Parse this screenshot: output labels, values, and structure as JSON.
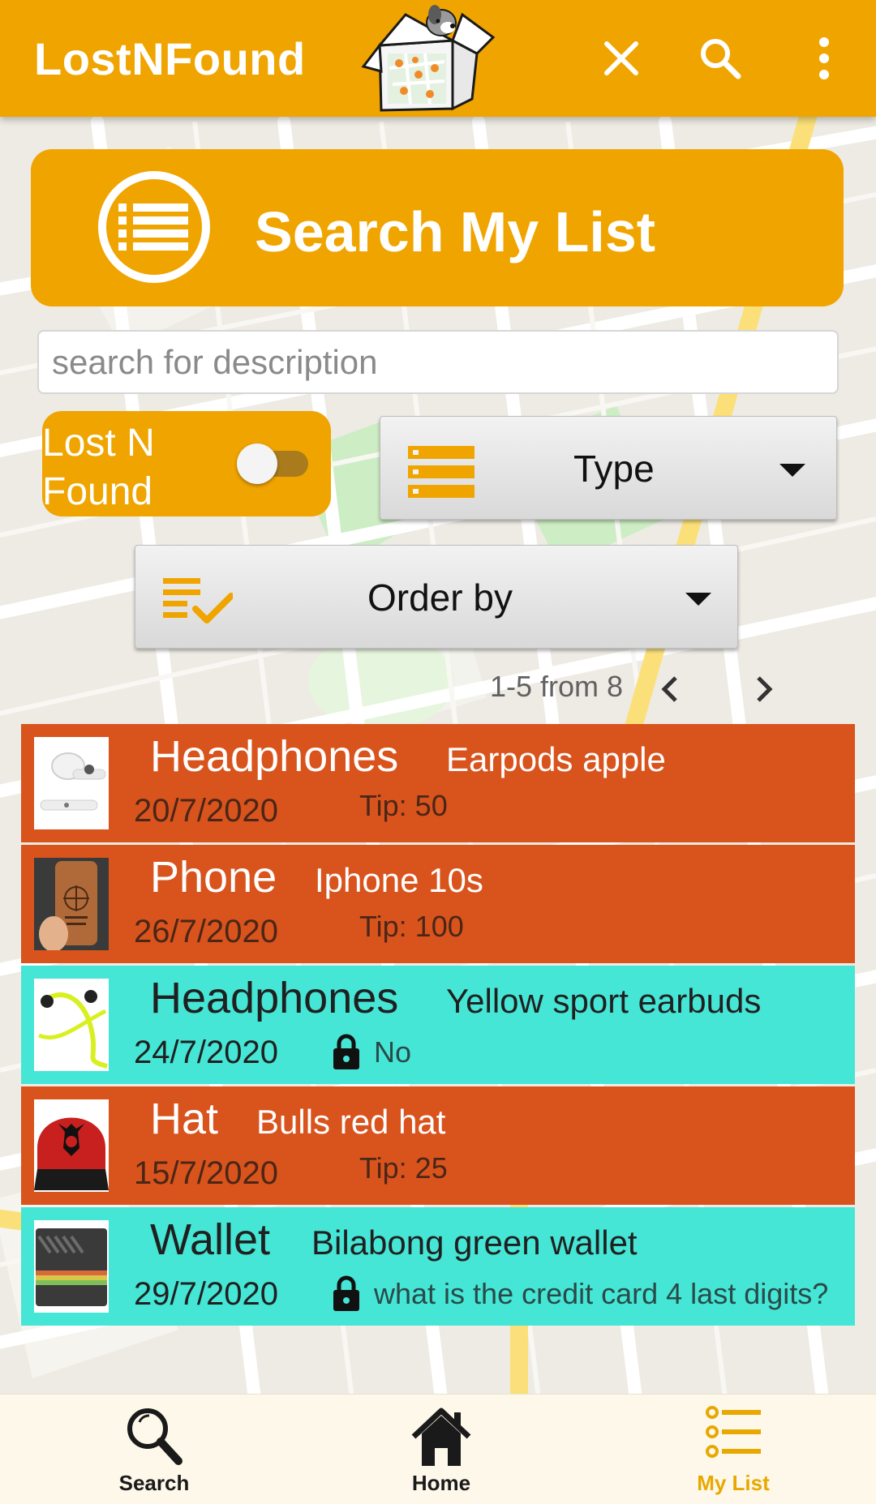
{
  "app_bar": {
    "title": "LostNFound",
    "icons": [
      "box-map-logo-icon",
      "close-icon",
      "search-icon",
      "more-vert-icon"
    ]
  },
  "banner": {
    "title": "Search My List",
    "icon": "list-circle-icon"
  },
  "search": {
    "placeholder": "search for description",
    "value": ""
  },
  "filters": {
    "lost_found_label": "Lost N Found",
    "lost_found_on": false,
    "type_label": "Type",
    "order_label": "Order by"
  },
  "pagination": {
    "info": "1-5 from 8"
  },
  "items": [
    {
      "status": "lost",
      "type": "Headphones",
      "description": "Earpods apple",
      "date": "20/7/2020",
      "extra": "Tip: 50"
    },
    {
      "status": "lost",
      "type": "Phone",
      "description": "Iphone 10s",
      "date": "26/7/2020",
      "extra": "Tip: 100"
    },
    {
      "status": "found",
      "type": "Headphones",
      "description": "Yellow sport earbuds",
      "date": "24/7/2020",
      "extra": "No"
    },
    {
      "status": "lost",
      "type": "Hat",
      "description": "Bulls red hat",
      "date": "15/7/2020",
      "extra": "Tip: 25"
    },
    {
      "status": "found",
      "type": "Wallet",
      "description": "Bilabong green wallet",
      "date": "29/7/2020",
      "extra": "what is the credit card 4 last digits?"
    }
  ],
  "bottom_nav": {
    "search": "Search",
    "home": "Home",
    "my_list": "My List",
    "active": "my_list"
  },
  "colors": {
    "accent": "#f0a400",
    "lost": "#d9531d",
    "found": "#45e6d6"
  }
}
